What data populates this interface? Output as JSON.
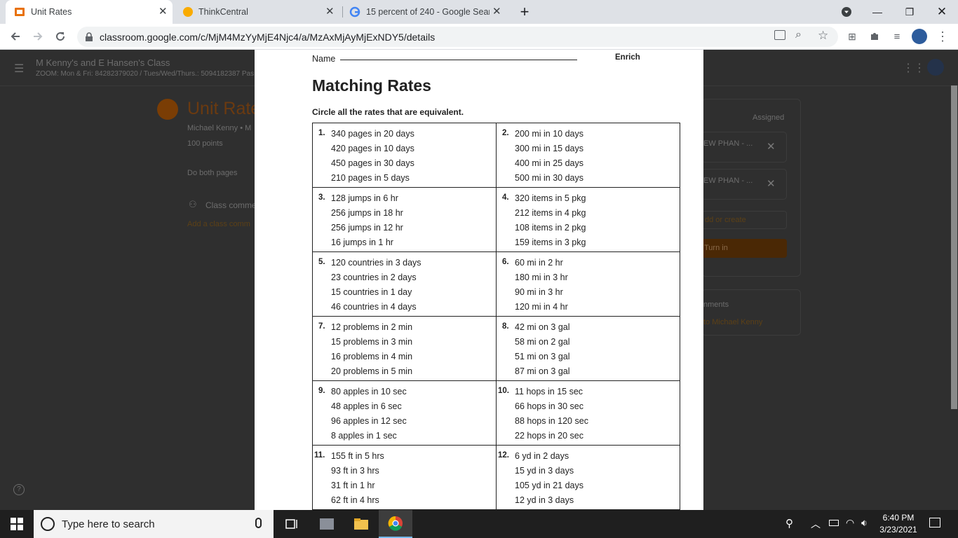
{
  "browser": {
    "tabs": [
      {
        "title": "Unit Rates",
        "favicon": "classroom-icon",
        "active": true
      },
      {
        "title": "ThinkCentral",
        "favicon": "thinkcentral-icon",
        "active": false
      },
      {
        "title": "15 percent of 240 - Google Searc",
        "favicon": "google-icon",
        "active": false
      }
    ],
    "url": "classroom.google.com/c/MjM4MzYyMjE4Njc4/a/MzAxMjAyMjExNDY5/details"
  },
  "classroom": {
    "class_name": "M Kenny's and E Hansen's Class",
    "class_subtitle": "ZOOM: Mon & Fri: 84282379020 / Tues/Wed/Thurs.: 5094182387 Pas",
    "assignment_title": "Unit Rate",
    "teacher": "Michael Kenny • M",
    "points": "100 points",
    "instructions": "Do both pages",
    "class_comments": "Class comme",
    "add_class_comment": "Add a class comm",
    "status": "Assigned",
    "attachments": [
      "EW PHAN - ...",
      "EW PHAN - ..."
    ],
    "add_or_create": "dd or create",
    "turn_in": "Turn in",
    "private_comments": "nments",
    "private_comment_to": "to Michael Kenny"
  },
  "worksheet": {
    "name_label": "Name",
    "lesson_label": "Enrich",
    "title": "Matching Rates",
    "instruction": "Circle all the rates that are equivalent.",
    "problems": [
      {
        "number": "1.",
        "rates": [
          "340 pages in 20 days",
          "420 pages in 10 days",
          "450 pages in 30 days",
          "210 pages in 5 days"
        ]
      },
      {
        "number": "2.",
        "rates": [
          "200 mi in 10 days",
          "300 mi in 15 days",
          "400 mi in 25 days",
          "500 mi in 30 days"
        ]
      },
      {
        "number": "3.",
        "rates": [
          "128 jumps in 6 hr",
          "256 jumps in 18 hr",
          "256 jumps in 12 hr",
          "16 jumps in 1 hr"
        ]
      },
      {
        "number": "4.",
        "rates": [
          "320 items in 5 pkg",
          "212 items in 4 pkg",
          "108 items in 2 pkg",
          "159 items in 3 pkg"
        ]
      },
      {
        "number": "5.",
        "rates": [
          "120 countries in 3 days",
          "23 countries in 2 days",
          "15 countries in 1 day",
          "46 countries in 4 days"
        ]
      },
      {
        "number": "6.",
        "rates": [
          "60 mi in 2 hr",
          "180 mi in 3 hr",
          "90 mi in 3 hr",
          "120 mi in 4 hr"
        ]
      },
      {
        "number": "7.",
        "rates": [
          "12 problems in 2 min",
          "15 problems in 3 min",
          "16 problems in 4 min",
          "20 problems in 5 min"
        ]
      },
      {
        "number": "8.",
        "rates": [
          "42 mi on 3 gal",
          "58 mi on 2 gal",
          "51 mi on 3 gal",
          "87 mi on 3 gal"
        ]
      },
      {
        "number": "9.",
        "rates": [
          "80 apples in 10 sec",
          "48 apples in 6 sec",
          "96 apples in 12 sec",
          "8 apples in 1 sec"
        ]
      },
      {
        "number": "10.",
        "rates": [
          "11 hops in 15 sec",
          "66 hops in 30 sec",
          "88 hops in 120 sec",
          "22 hops in 20 sec"
        ]
      },
      {
        "number": "11.",
        "rates": [
          "155 ft in 5 hrs",
          "93 ft in 3 hrs",
          "31 ft in 1 hr",
          "62 ft in 4 hrs"
        ]
      },
      {
        "number": "12.",
        "rates": [
          "6 yd in 2 days",
          "15 yd in 3 days",
          "105 yd in 21 days",
          "12 yd in 3 days"
        ]
      }
    ]
  },
  "taskbar": {
    "search_placeholder": "Type here to search",
    "time": "6:40 PM",
    "date": "3/23/2021"
  }
}
